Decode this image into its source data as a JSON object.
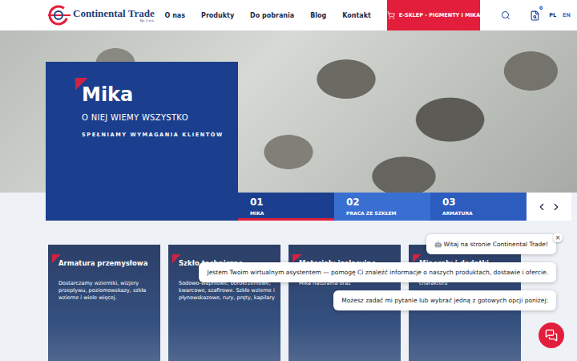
{
  "header": {
    "logo": {
      "name": "Continental Trade",
      "sub": "Sp. z o.o."
    },
    "nav": [
      "O nas",
      "Produkty",
      "Do pobrania",
      "Blog",
      "Kontakt"
    ],
    "shop_button": "E-SKLEP - PIGMENTY I MIKA",
    "cart_badge": "0",
    "languages": [
      {
        "label": "PL",
        "selected": true
      },
      {
        "label": "EN",
        "selected": false
      }
    ]
  },
  "hero": {
    "title": "Mika",
    "subtitle": "O NIEJ WIEMY WSZYSTKO",
    "tagline": "SPEŁNIAMY WYMAGANIA KLIENTÓW",
    "slides": [
      {
        "number": "01",
        "label": "MIKA",
        "selected": true,
        "color": "#1b3f8e"
      },
      {
        "number": "02",
        "label": "PRACA ZE SZKŁEM",
        "selected": false,
        "color": "#3a6fd2"
      },
      {
        "number": "03",
        "label": "ARMATURA",
        "selected": false,
        "color": "#2d5cbf"
      }
    ]
  },
  "cards": [
    {
      "title": "Armatura przemysłowa",
      "text": "Dostarczamy wzierniki, wizjery przepływu, poziomowskazy, szkła wzierne i wiele więcej."
    },
    {
      "title": "Szkło techniczne",
      "text": "Sodowo-wapniowe, borokrzemowe, kwarcowe, szafirowe. Szkło wzierne i płynowskazowe, rury, pręty, kapilary"
    },
    {
      "title": "Materiały izolacyjne",
      "text": "Mika naturalna oraz"
    },
    {
      "title": "Minerały i dodatki",
      "text": "charakteru"
    }
  ],
  "chat": {
    "close": "×",
    "messages": [
      "🤖 Witaj na stronie Continental Trade!",
      "Jestem Twoim wirtualnym asystentem — pomogę Ci znaleźć informacje o naszych produktach, dostawie i ofercie.",
      "Możesz zadać mi pytanie lub wybrać jedną z gotowych opcji poniżej:"
    ]
  }
}
